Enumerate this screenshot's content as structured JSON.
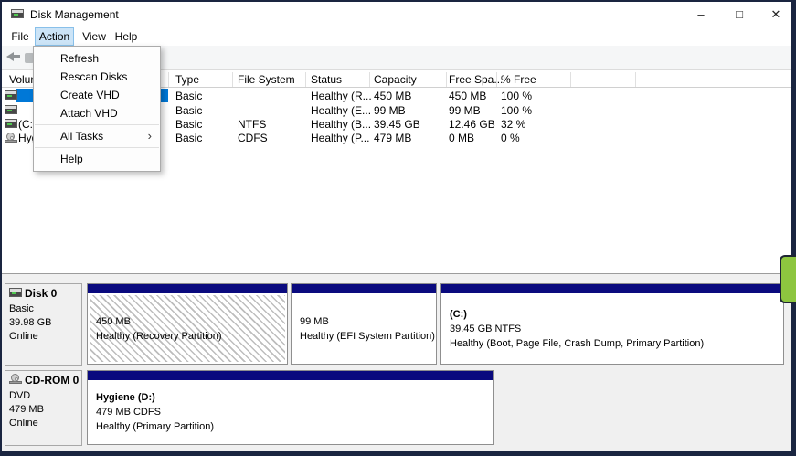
{
  "window": {
    "title": "Disk Management",
    "controls": {
      "minimize": "–",
      "maximize": "□",
      "close": "✕"
    }
  },
  "menu_bar": {
    "items": [
      "File",
      "Action",
      "View",
      "Help"
    ],
    "active_item": "Action"
  },
  "action_menu": {
    "items": [
      "Refresh",
      "Rescan Disks",
      "Create VHD",
      "Attach VHD",
      "All Tasks",
      "Help"
    ],
    "submenu_arrow": "›"
  },
  "volume_list": {
    "columns": [
      "Volume",
      "Type",
      "File System",
      "Status",
      "Capacity",
      "Free Spa...",
      "% Free"
    ],
    "rows": [
      {
        "volume": "",
        "type": "Basic",
        "file_system": "",
        "status": "Healthy (R...",
        "capacity": "450 MB",
        "free_space": "450 MB",
        "pct_free": "100 %"
      },
      {
        "volume": "",
        "type": "Basic",
        "file_system": "",
        "status": "Healthy (E...",
        "capacity": "99 MB",
        "free_space": "99 MB",
        "pct_free": "100 %"
      },
      {
        "volume": "(C:)",
        "type": "Basic",
        "file_system": "NTFS",
        "status": "Healthy (B...",
        "capacity": "39.45 GB",
        "free_space": "12.46 GB",
        "pct_free": "32 %"
      },
      {
        "volume": "Hygiene (D:)",
        "type": "Basic",
        "file_system": "CDFS",
        "status": "Healthy (P...",
        "capacity": "479 MB",
        "free_space": "0 MB",
        "pct_free": "0 %"
      }
    ]
  },
  "disks": [
    {
      "label": "Disk 0",
      "lines": [
        "Basic",
        "39.98 GB",
        "Online"
      ],
      "partitions": [
        {
          "title": "",
          "size_line": "450 MB",
          "status_line": "Healthy (Recovery Partition)"
        },
        {
          "title": "",
          "size_line": "99 MB",
          "status_line": "Healthy (EFI System Partition)"
        },
        {
          "title": "(C:)",
          "size_line": "39.45 GB NTFS",
          "status_line": "Healthy (Boot, Page File, Crash Dump, Primary Partition)"
        }
      ]
    },
    {
      "label": "CD-ROM 0",
      "lines": [
        "DVD",
        "479 MB",
        "Online"
      ],
      "partitions": [
        {
          "title": "Hygiene  (D:)",
          "size_line": "479 MB CDFS",
          "status_line": "Healthy (Primary Partition)"
        }
      ]
    }
  ],
  "colors": {
    "partition_bar": "#0a0a7e",
    "selection": "#0078d7",
    "menu_highlight": "#cce4f7",
    "green_tab": "#8dc63f",
    "window_border": "#1a2540"
  }
}
